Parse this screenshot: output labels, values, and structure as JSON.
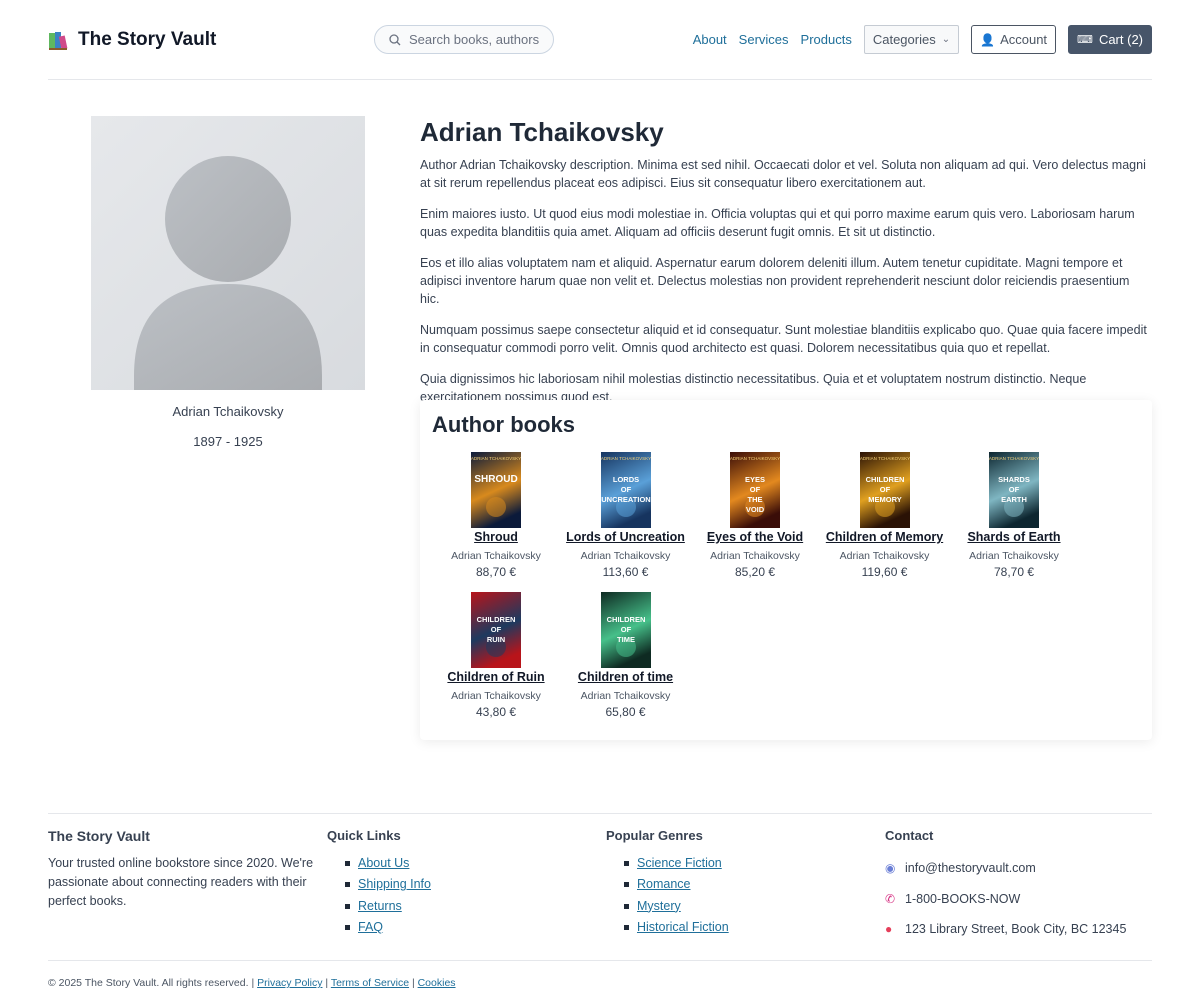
{
  "header": {
    "brand": "The Story Vault",
    "search_placeholder": "Search books, authors",
    "nav": [
      "About",
      "Services",
      "Products"
    ],
    "categories_label": "Categories",
    "account_label": "Account",
    "cart_label": "Cart (2)"
  },
  "author": {
    "name": "Adrian Tchaikovsky",
    "caption": "Adrian Tchaikovsky",
    "years": "1897 - 1925",
    "bio": [
      "Author Adrian Tchaikovsky description. Minima est sed nihil. Occaecati dolor et vel. Soluta non aliquam ad qui. Vero delectus magni at sit rerum repellendus placeat eos adipisci. Eius sit consequatur libero exercitationem aut.",
      "Enim maiores iusto. Ut quod eius modi molestiae in. Officia voluptas qui et qui porro maxime earum quis vero. Laboriosam harum quas expedita blanditiis quia amet. Aliquam ad officiis deserunt fugit omnis. Et sit ut distinctio.",
      "Eos et illo alias voluptatem nam et aliquid. Aspernatur earum dolorem deleniti illum. Autem tenetur cupiditate. Magni tempore et adipisci inventore harum quae non velit et. Delectus molestias non provident reprehenderit nesciunt dolor reiciendis praesentium hic.",
      "Numquam possimus saepe consectetur aliquid et id consequatur. Sunt molestiae blanditiis explicabo quo. Quae quia facere impedit in consequatur commodi porro velit. Omnis quod architecto est quasi. Dolorem necessitatibus quia quo et repellat.",
      "Quia dignissimos hic laboriosam nihil molestias distinctio necessitatibus. Quia et et voluptatem nostrum distinctio. Neque exercitationem possimus quod est."
    ]
  },
  "books_section": {
    "heading": "Author books",
    "books": [
      {
        "title": "Shroud",
        "author": "Adrian Tchaikovsky",
        "price": "88,70 €",
        "cover_author": "ADRIAN TCHAIKOVSKY",
        "cover_title": "SHROUD",
        "colors": [
          "#0b1a3a",
          "#d88a1d"
        ]
      },
      {
        "title": "Lords of Uncreation",
        "author": "Adrian Tchaikovsky",
        "price": "113,60 €",
        "cover_author": "ADRIAN TCHAIKOVSKY",
        "cover_title": "LORDS OF UNCREATION",
        "colors": [
          "#16345f",
          "#5aa0d8"
        ]
      },
      {
        "title": "Eyes of the Void",
        "author": "Adrian Tchaikovsky",
        "price": "85,20 €",
        "cover_author": "ADRIAN TCHAIKOVSKY",
        "cover_title": "EYES OF THE VOID",
        "colors": [
          "#3a0d08",
          "#e3891f"
        ]
      },
      {
        "title": "Children of Memory",
        "author": "Adrian Tchaikovsky",
        "price": "119,60 €",
        "cover_author": "ADRIAN TCHAIKOVSKY",
        "cover_title": "CHILDREN OF MEMORY",
        "colors": [
          "#2a1205",
          "#e0a020"
        ]
      },
      {
        "title": "Shards of Earth",
        "author": "Adrian Tchaikovsky",
        "price": "78,70 €",
        "cover_author": "ADRIAN TCHAIKOVSKY",
        "cover_title": "SHARDS OF EARTH",
        "colors": [
          "#0d2630",
          "#7fb6c2"
        ]
      },
      {
        "title": "Children of Ruin",
        "author": "Adrian Tchaikovsky",
        "price": "43,80 €",
        "cover_author": "",
        "cover_title": "CHILDREN OF RUIN",
        "colors": [
          "#b8141a",
          "#1e3a5f"
        ]
      },
      {
        "title": "Children of time",
        "author": "Adrian Tchaikovsky",
        "price": "65,80 €",
        "cover_author": "",
        "cover_title": "CHILDREN OF TIME",
        "colors": [
          "#0e2a22",
          "#46c08a"
        ]
      }
    ]
  },
  "footer": {
    "brand": "The Story Vault",
    "about": "Your trusted online bookstore since 2020. We're passionate about connecting readers with their perfect books.",
    "quick_links_heading": "Quick Links",
    "quick_links": [
      "About Us",
      "Shipping Info",
      "Returns",
      "FAQ"
    ],
    "genres_heading": "Popular Genres",
    "genres": [
      "Science Fiction",
      "Romance",
      "Mystery",
      "Historical Fiction"
    ],
    "contact_heading": "Contact",
    "contact": [
      {
        "icon": "email-icon",
        "text": "info@thestoryvault.com"
      },
      {
        "icon": "phone-icon",
        "text": "1-800-BOOKS-NOW"
      },
      {
        "icon": "pin-icon",
        "text": "123 Library Street, Book City, BC 12345"
      }
    ],
    "copyright": "© 2025 The Story Vault. All rights reserved. |",
    "legal_links": [
      "Privacy Policy",
      "Terms of Service",
      "Cookies"
    ]
  }
}
